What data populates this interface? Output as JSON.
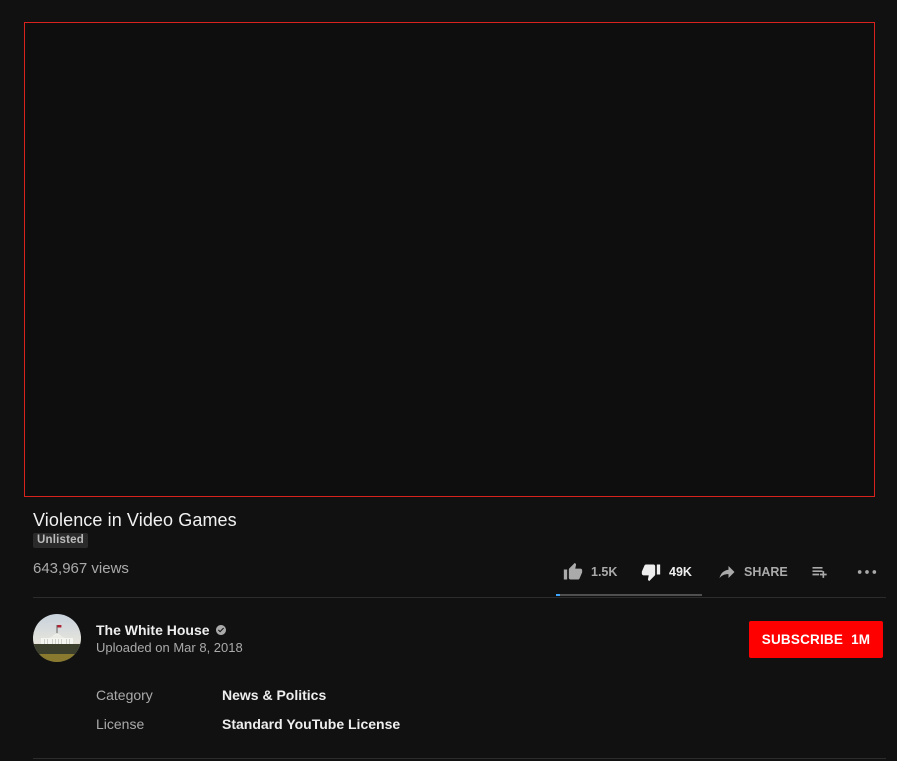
{
  "video": {
    "title": "Violence in Video Games",
    "privacy_badge": "Unlisted",
    "views": "643,967 views"
  },
  "actions": {
    "likes": "1.5K",
    "dislikes": "49K",
    "share_label": "SHARE",
    "like_ratio": 0.03
  },
  "channel": {
    "name": "The White House",
    "verified": true,
    "upload_date": "Uploaded on Mar 8, 2018",
    "subscribe_label": "SUBSCRIBE",
    "subscriber_count": "1M"
  },
  "metadata": [
    {
      "key": "Category",
      "value": "News & Politics"
    },
    {
      "key": "License",
      "value": "Standard YouTube License"
    }
  ],
  "colors": {
    "background": "#111111",
    "player_border": "#d7221e",
    "subscribe": "#ff0000",
    "sentiment_fill": "#3ea6ff"
  },
  "icons": [
    "thumbs-up-icon",
    "thumbs-down-icon",
    "share-icon",
    "add-to-playlist-icon",
    "more-options-icon",
    "verified-icon"
  ]
}
